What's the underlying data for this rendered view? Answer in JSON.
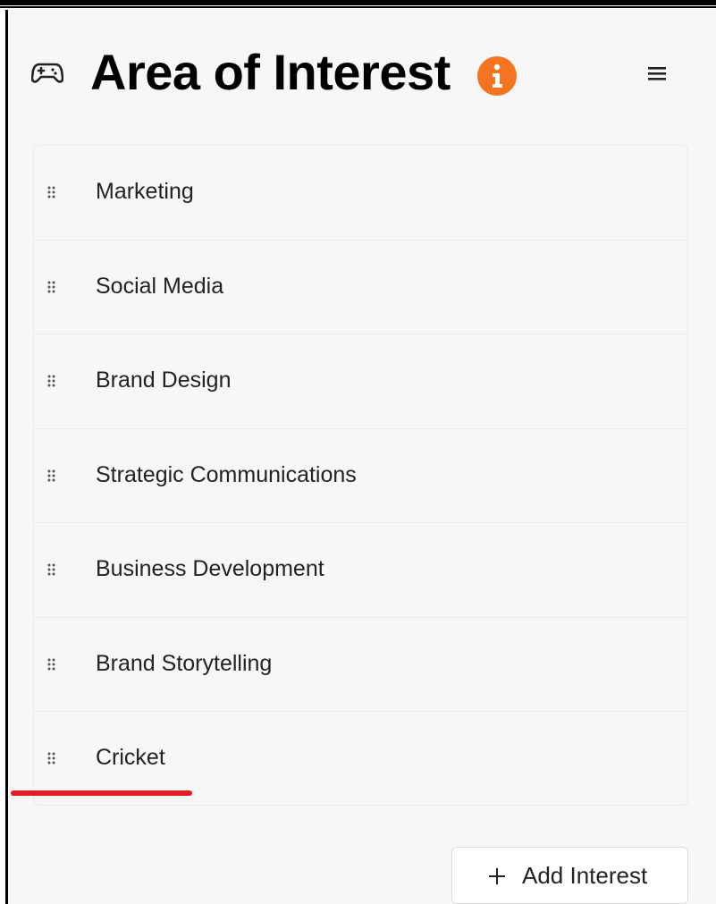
{
  "header": {
    "title": "Area of Interest",
    "icon": "gamepad-icon",
    "info_icon": "info-icon",
    "info_color": "#f47321",
    "menu_icon": "hamburger-menu-icon"
  },
  "interests": {
    "items": [
      {
        "label": "Marketing"
      },
      {
        "label": "Social Media"
      },
      {
        "label": "Brand Design"
      },
      {
        "label": "Strategic Communications"
      },
      {
        "label": "Business Development"
      },
      {
        "label": "Brand Storytelling"
      },
      {
        "label": "Cricket"
      }
    ],
    "drag_icon": "drag-handle-icon",
    "highlight_color": "#e01e25"
  },
  "actions": {
    "add_label": "Add Interest",
    "add_icon": "plus-icon"
  }
}
